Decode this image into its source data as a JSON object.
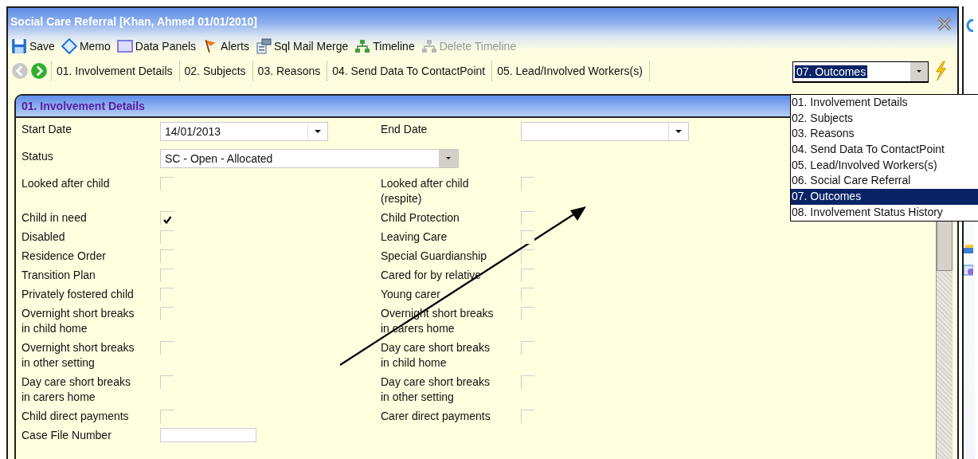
{
  "window": {
    "title": "Social Care Referral [Khan, Ahmed 01/01/2010]"
  },
  "toolbar": [
    {
      "kind": "save",
      "label": "Save",
      "disabled": false
    },
    {
      "kind": "memo",
      "label": "Memo",
      "disabled": false
    },
    {
      "kind": "panels",
      "label": "Data Panels",
      "disabled": false
    },
    {
      "kind": "alerts",
      "label": "Alerts",
      "disabled": false
    },
    {
      "kind": "mailmerge",
      "label": "Sql Mail Merge",
      "disabled": false
    },
    {
      "kind": "timeline",
      "label": "Timeline",
      "disabled": false
    },
    {
      "kind": "timeline",
      "label": "Delete Timeline",
      "disabled": true
    }
  ],
  "nav": {
    "back_disabled": true,
    "forward_disabled": false,
    "tabs": [
      "01. Involvement Details",
      "02. Subjects",
      "03. Reasons",
      "04. Send Data To ContactPoint",
      "05. Lead/Involved Workers(s)"
    ]
  },
  "section_select": {
    "value": "07. Outcomes",
    "expanded": true,
    "options": [
      {
        "label": "01. Involvement Details",
        "selected": false
      },
      {
        "label": "02. Subjects",
        "selected": false
      },
      {
        "label": "03. Reasons",
        "selected": false
      },
      {
        "label": "04. Send Data To ContactPoint",
        "selected": false
      },
      {
        "label": "05. Lead/Involved Workers(s)",
        "selected": false
      },
      {
        "label": "06. Social Care Referral",
        "selected": false
      },
      {
        "label": "07. Outcomes",
        "selected": true
      },
      {
        "label": "08. Involvement Status History",
        "selected": false
      }
    ]
  },
  "section": {
    "title": "01. Involvement Details",
    "rows": [
      {
        "left": {
          "kind": "date",
          "label": "Start Date",
          "value": "14/01/2013"
        },
        "right": {
          "kind": "date",
          "label": "End Date"
        }
      },
      {
        "left": {
          "kind": "select",
          "label": "Status",
          "value": "SC - Open - Allocated"
        }
      },
      {
        "left": {
          "kind": "checkbox",
          "label": "Looked after child",
          "checked": false
        },
        "right": {
          "kind": "checkbox",
          "label": "Looked after child\n(respite)",
          "checked": false
        }
      },
      {
        "left": {
          "kind": "checkbox",
          "label": "Child in need",
          "checked": true
        },
        "right": {
          "kind": "checkbox",
          "label": "Child Protection",
          "checked": false
        }
      },
      {
        "left": {
          "kind": "checkbox",
          "label": "Disabled",
          "checked": false
        },
        "right": {
          "kind": "checkbox",
          "label": "Leaving Care",
          "checked": false
        }
      },
      {
        "left": {
          "kind": "checkbox",
          "label": "Residence Order",
          "checked": false
        },
        "right": {
          "kind": "checkbox",
          "label": "Special Guardianship",
          "checked": false
        }
      },
      {
        "left": {
          "kind": "checkbox",
          "label": "Transition Plan",
          "checked": false
        },
        "right": {
          "kind": "checkbox",
          "label": "Cared for by relative",
          "checked": false
        }
      },
      {
        "left": {
          "kind": "checkbox",
          "label": "Privately fostered child",
          "checked": false
        },
        "right": {
          "kind": "checkbox",
          "label": "Young carer",
          "checked": false
        }
      },
      {
        "left": {
          "kind": "checkbox",
          "label": "Overnight short breaks\nin child home",
          "checked": false
        },
        "right": {
          "kind": "checkbox",
          "label": "Overnight short breaks\nin carers home",
          "checked": false
        }
      },
      {
        "left": {
          "kind": "checkbox",
          "label": "Overnight short breaks\nin other setting",
          "checked": false
        },
        "right": {
          "kind": "checkbox",
          "label": "Day care short breaks\nin child home",
          "checked": false
        }
      },
      {
        "left": {
          "kind": "checkbox",
          "label": "Day care short breaks\nin carers home",
          "checked": false
        },
        "right": {
          "kind": "checkbox",
          "label": "Day care short breaks\nin other setting",
          "checked": false
        }
      },
      {
        "left": {
          "kind": "checkbox",
          "label": "Child direct payments",
          "checked": false
        },
        "right": {
          "kind": "checkbox",
          "label": "Carer direct payments",
          "checked": false
        }
      },
      {
        "left": {
          "kind": "text",
          "label": "Case File Number"
        }
      }
    ]
  }
}
